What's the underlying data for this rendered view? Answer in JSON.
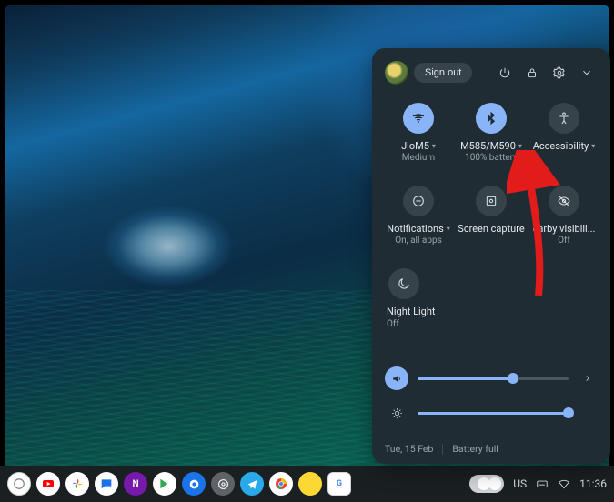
{
  "header": {
    "signout_label": "Sign out"
  },
  "tiles": {
    "wifi": {
      "label": "JioM5",
      "sub": "Medium"
    },
    "bluetooth": {
      "label": "M585/M590",
      "sub": "100% battery"
    },
    "accessibility": {
      "label": "Accessibility"
    },
    "notifications": {
      "label": "Notifications",
      "sub": "On, all apps"
    },
    "screencapture": {
      "label": "Screen capture"
    },
    "nearby": {
      "label": "earby visibili...",
      "sub": "Off"
    },
    "nightlight": {
      "label": "Night Light",
      "sub": "Off"
    }
  },
  "sliders": {
    "volume_pct": 63,
    "brightness_pct": 100
  },
  "footer": {
    "date": "Tue, 15 Feb",
    "battery": "Battery full"
  },
  "shelf": {
    "ime": "US",
    "time": "11:36"
  }
}
